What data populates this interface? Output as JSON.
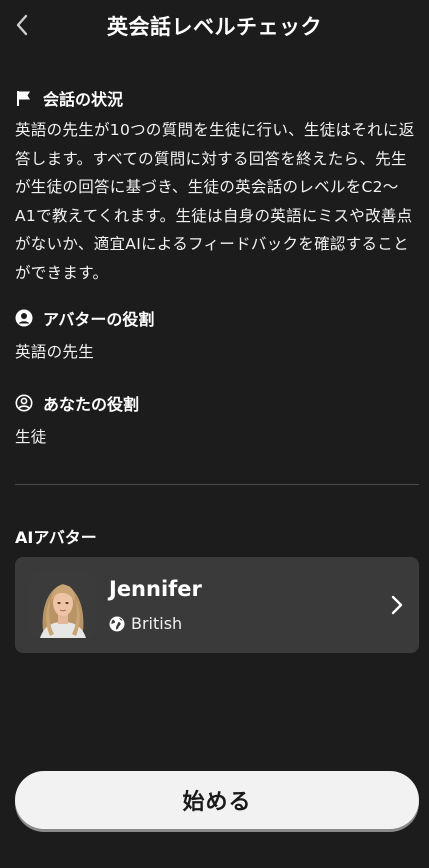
{
  "header": {
    "title": "英会話レベルチェック",
    "back_icon": "chevron-left-icon"
  },
  "situation": {
    "icon": "flag-icon",
    "heading": "会話の状況",
    "text": "英語の先生が10つの質問を生徒に行い、生徒はそれに返答します。すべての質問に対する回答を終えたら、先生が生徒の回答に基づき、生徒の英会話のレベルをC2〜A1で教えてくれます。生徒は自身の英語にミスや改善点がないか、適宜AIによるフィードバックを確認することができます。"
  },
  "avatar_role": {
    "icon": "user-circle-filled-icon",
    "heading": "アバターの役割",
    "value": "英語の先生"
  },
  "your_role": {
    "icon": "user-circle-outline-icon",
    "heading": "あなたの役割",
    "value": "生徒"
  },
  "ai_avatar": {
    "label": "AIアバター",
    "name": "Jennifer",
    "accent_icon": "globe-icon",
    "accent": "British"
  },
  "start_button": {
    "label": "始める"
  }
}
